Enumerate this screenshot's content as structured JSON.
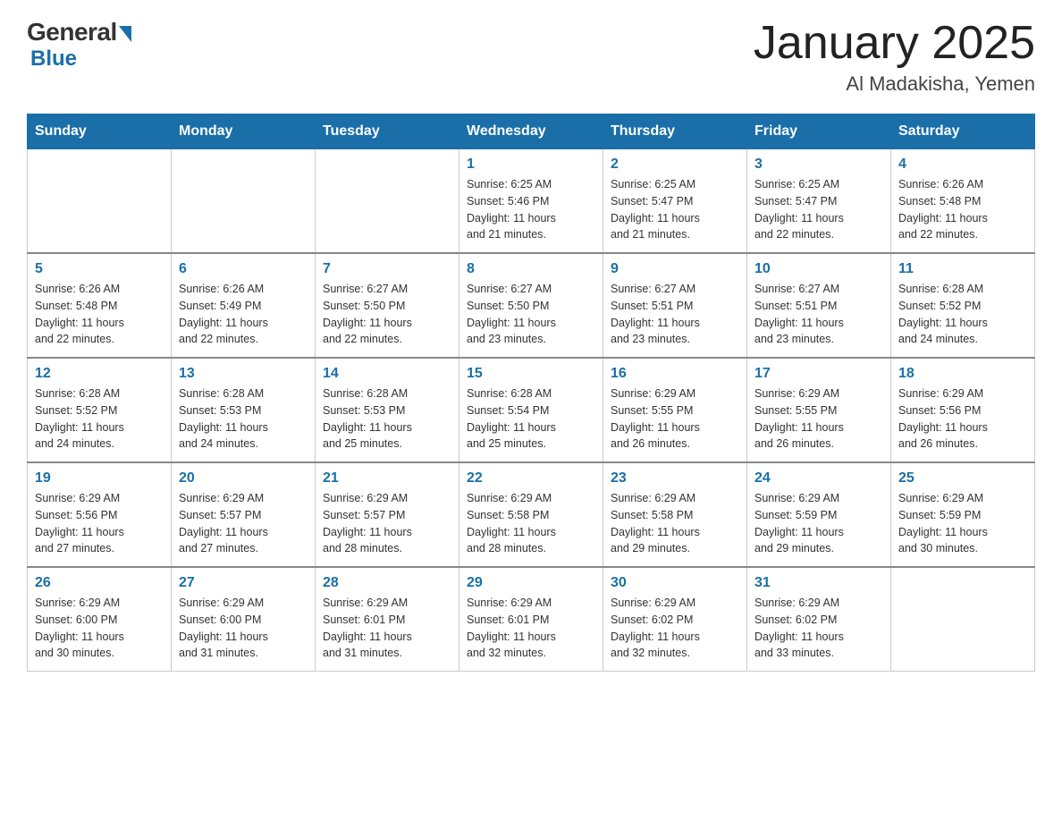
{
  "header": {
    "logo": {
      "general": "General",
      "blue": "Blue"
    },
    "title": "January 2025",
    "location": "Al Madakisha, Yemen"
  },
  "weekdays": [
    "Sunday",
    "Monday",
    "Tuesday",
    "Wednesday",
    "Thursday",
    "Friday",
    "Saturday"
  ],
  "weeks": [
    [
      {
        "day": "",
        "info": ""
      },
      {
        "day": "",
        "info": ""
      },
      {
        "day": "",
        "info": ""
      },
      {
        "day": "1",
        "info": "Sunrise: 6:25 AM\nSunset: 5:46 PM\nDaylight: 11 hours\nand 21 minutes."
      },
      {
        "day": "2",
        "info": "Sunrise: 6:25 AM\nSunset: 5:47 PM\nDaylight: 11 hours\nand 21 minutes."
      },
      {
        "day": "3",
        "info": "Sunrise: 6:25 AM\nSunset: 5:47 PM\nDaylight: 11 hours\nand 22 minutes."
      },
      {
        "day": "4",
        "info": "Sunrise: 6:26 AM\nSunset: 5:48 PM\nDaylight: 11 hours\nand 22 minutes."
      }
    ],
    [
      {
        "day": "5",
        "info": "Sunrise: 6:26 AM\nSunset: 5:48 PM\nDaylight: 11 hours\nand 22 minutes."
      },
      {
        "day": "6",
        "info": "Sunrise: 6:26 AM\nSunset: 5:49 PM\nDaylight: 11 hours\nand 22 minutes."
      },
      {
        "day": "7",
        "info": "Sunrise: 6:27 AM\nSunset: 5:50 PM\nDaylight: 11 hours\nand 22 minutes."
      },
      {
        "day": "8",
        "info": "Sunrise: 6:27 AM\nSunset: 5:50 PM\nDaylight: 11 hours\nand 23 minutes."
      },
      {
        "day": "9",
        "info": "Sunrise: 6:27 AM\nSunset: 5:51 PM\nDaylight: 11 hours\nand 23 minutes."
      },
      {
        "day": "10",
        "info": "Sunrise: 6:27 AM\nSunset: 5:51 PM\nDaylight: 11 hours\nand 23 minutes."
      },
      {
        "day": "11",
        "info": "Sunrise: 6:28 AM\nSunset: 5:52 PM\nDaylight: 11 hours\nand 24 minutes."
      }
    ],
    [
      {
        "day": "12",
        "info": "Sunrise: 6:28 AM\nSunset: 5:52 PM\nDaylight: 11 hours\nand 24 minutes."
      },
      {
        "day": "13",
        "info": "Sunrise: 6:28 AM\nSunset: 5:53 PM\nDaylight: 11 hours\nand 24 minutes."
      },
      {
        "day": "14",
        "info": "Sunrise: 6:28 AM\nSunset: 5:53 PM\nDaylight: 11 hours\nand 25 minutes."
      },
      {
        "day": "15",
        "info": "Sunrise: 6:28 AM\nSunset: 5:54 PM\nDaylight: 11 hours\nand 25 minutes."
      },
      {
        "day": "16",
        "info": "Sunrise: 6:29 AM\nSunset: 5:55 PM\nDaylight: 11 hours\nand 26 minutes."
      },
      {
        "day": "17",
        "info": "Sunrise: 6:29 AM\nSunset: 5:55 PM\nDaylight: 11 hours\nand 26 minutes."
      },
      {
        "day": "18",
        "info": "Sunrise: 6:29 AM\nSunset: 5:56 PM\nDaylight: 11 hours\nand 26 minutes."
      }
    ],
    [
      {
        "day": "19",
        "info": "Sunrise: 6:29 AM\nSunset: 5:56 PM\nDaylight: 11 hours\nand 27 minutes."
      },
      {
        "day": "20",
        "info": "Sunrise: 6:29 AM\nSunset: 5:57 PM\nDaylight: 11 hours\nand 27 minutes."
      },
      {
        "day": "21",
        "info": "Sunrise: 6:29 AM\nSunset: 5:57 PM\nDaylight: 11 hours\nand 28 minutes."
      },
      {
        "day": "22",
        "info": "Sunrise: 6:29 AM\nSunset: 5:58 PM\nDaylight: 11 hours\nand 28 minutes."
      },
      {
        "day": "23",
        "info": "Sunrise: 6:29 AM\nSunset: 5:58 PM\nDaylight: 11 hours\nand 29 minutes."
      },
      {
        "day": "24",
        "info": "Sunrise: 6:29 AM\nSunset: 5:59 PM\nDaylight: 11 hours\nand 29 minutes."
      },
      {
        "day": "25",
        "info": "Sunrise: 6:29 AM\nSunset: 5:59 PM\nDaylight: 11 hours\nand 30 minutes."
      }
    ],
    [
      {
        "day": "26",
        "info": "Sunrise: 6:29 AM\nSunset: 6:00 PM\nDaylight: 11 hours\nand 30 minutes."
      },
      {
        "day": "27",
        "info": "Sunrise: 6:29 AM\nSunset: 6:00 PM\nDaylight: 11 hours\nand 31 minutes."
      },
      {
        "day": "28",
        "info": "Sunrise: 6:29 AM\nSunset: 6:01 PM\nDaylight: 11 hours\nand 31 minutes."
      },
      {
        "day": "29",
        "info": "Sunrise: 6:29 AM\nSunset: 6:01 PM\nDaylight: 11 hours\nand 32 minutes."
      },
      {
        "day": "30",
        "info": "Sunrise: 6:29 AM\nSunset: 6:02 PM\nDaylight: 11 hours\nand 32 minutes."
      },
      {
        "day": "31",
        "info": "Sunrise: 6:29 AM\nSunset: 6:02 PM\nDaylight: 11 hours\nand 33 minutes."
      },
      {
        "day": "",
        "info": ""
      }
    ]
  ]
}
